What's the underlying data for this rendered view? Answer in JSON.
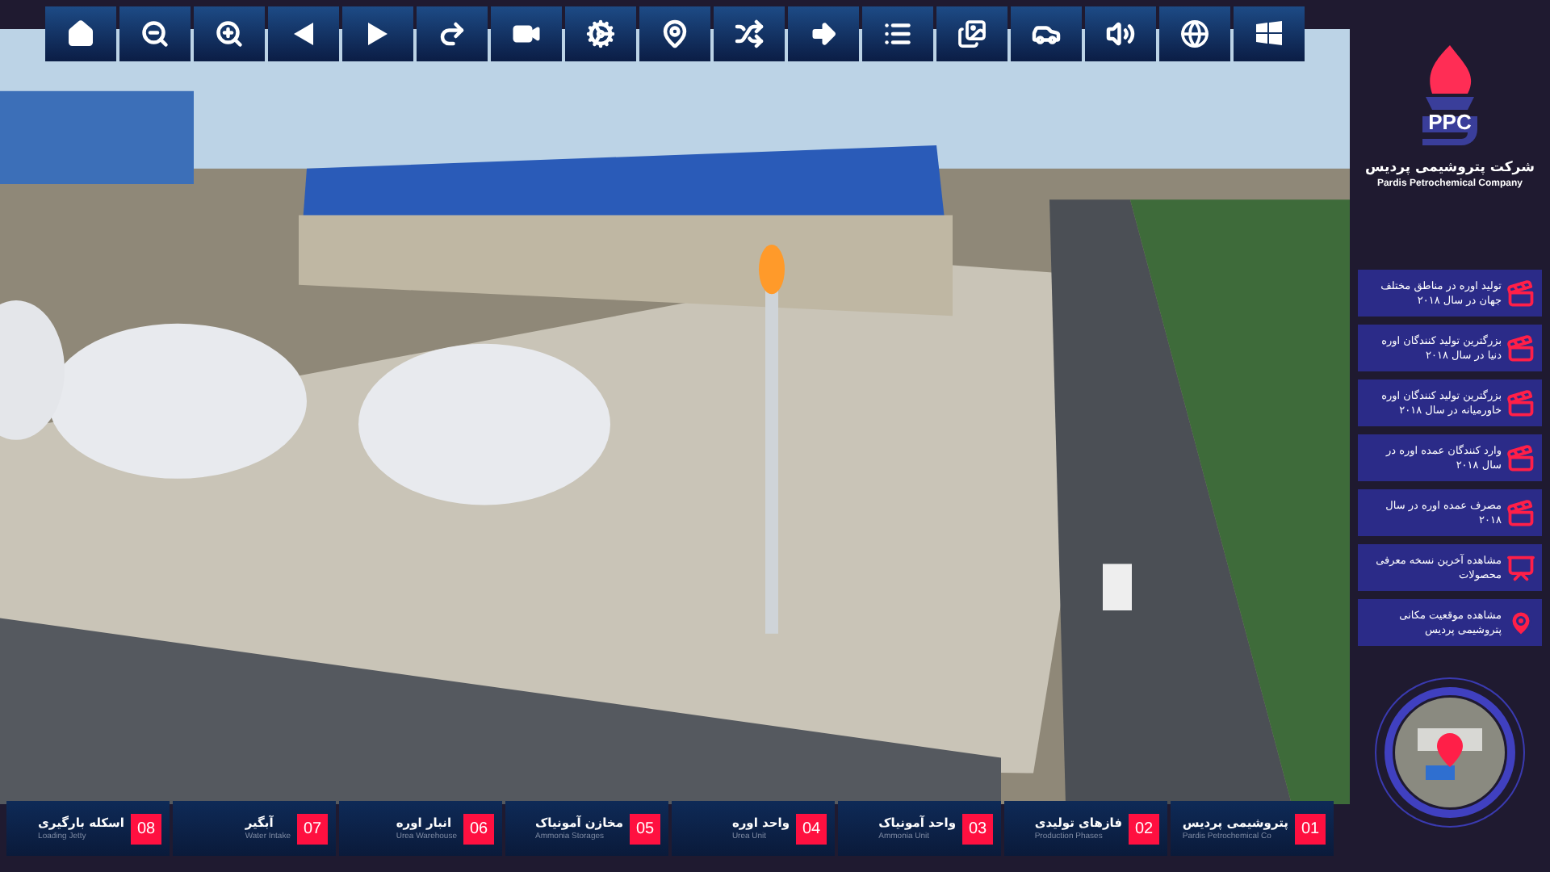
{
  "logo": {
    "mark": "PPC",
    "name_fa": "شرکت پتروشیمی پردیس",
    "name_en": "Pardis Petrochemical Company"
  },
  "side_menu": [
    {
      "kind": "video",
      "text": "تولید اوره در مناطق مختلف جهان در سال ۲۰۱۸"
    },
    {
      "kind": "video",
      "text": "بزرگترین تولید کنندگان اوره دنیا در سال ۲۰۱۸"
    },
    {
      "kind": "video",
      "text": "بزرگترین تولید کنندگان اوره خاورمیانه در سال ۲۰۱۸"
    },
    {
      "kind": "video",
      "text": "وارد کنندگان عمده اوره در سال ۲۰۱۸"
    },
    {
      "kind": "video",
      "text": "مصرف عمده اوره در سال ۲۰۱۸"
    },
    {
      "kind": "slides",
      "text": "مشاهده آخرین نسخه معرفی محصولات"
    },
    {
      "kind": "location",
      "text": "مشاهده موقعیت مکانی پتروشیمی پردیس"
    }
  ],
  "bottom_tabs": [
    {
      "number": "01",
      "title": "پتروشیمی پردیس",
      "subtitle": "Pardis Petrochemical Co"
    },
    {
      "number": "02",
      "title": "فازهای تولیدی",
      "subtitle": "Production Phases"
    },
    {
      "number": "03",
      "title": "واحد آمونیاک",
      "subtitle": "Ammonia Unit"
    },
    {
      "number": "04",
      "title": "واحد اوره",
      "subtitle": "Urea Unit"
    },
    {
      "number": "05",
      "title": "مخازن آمونیاک",
      "subtitle": "Ammonia Storages"
    },
    {
      "number": "06",
      "title": "انبار اوره",
      "subtitle": "Urea Warehouse"
    },
    {
      "number": "07",
      "title": "آبگیر",
      "subtitle": "Water Intake"
    },
    {
      "number": "08",
      "title": "اسکله بارگیری",
      "subtitle": "Loading Jetty"
    }
  ]
}
